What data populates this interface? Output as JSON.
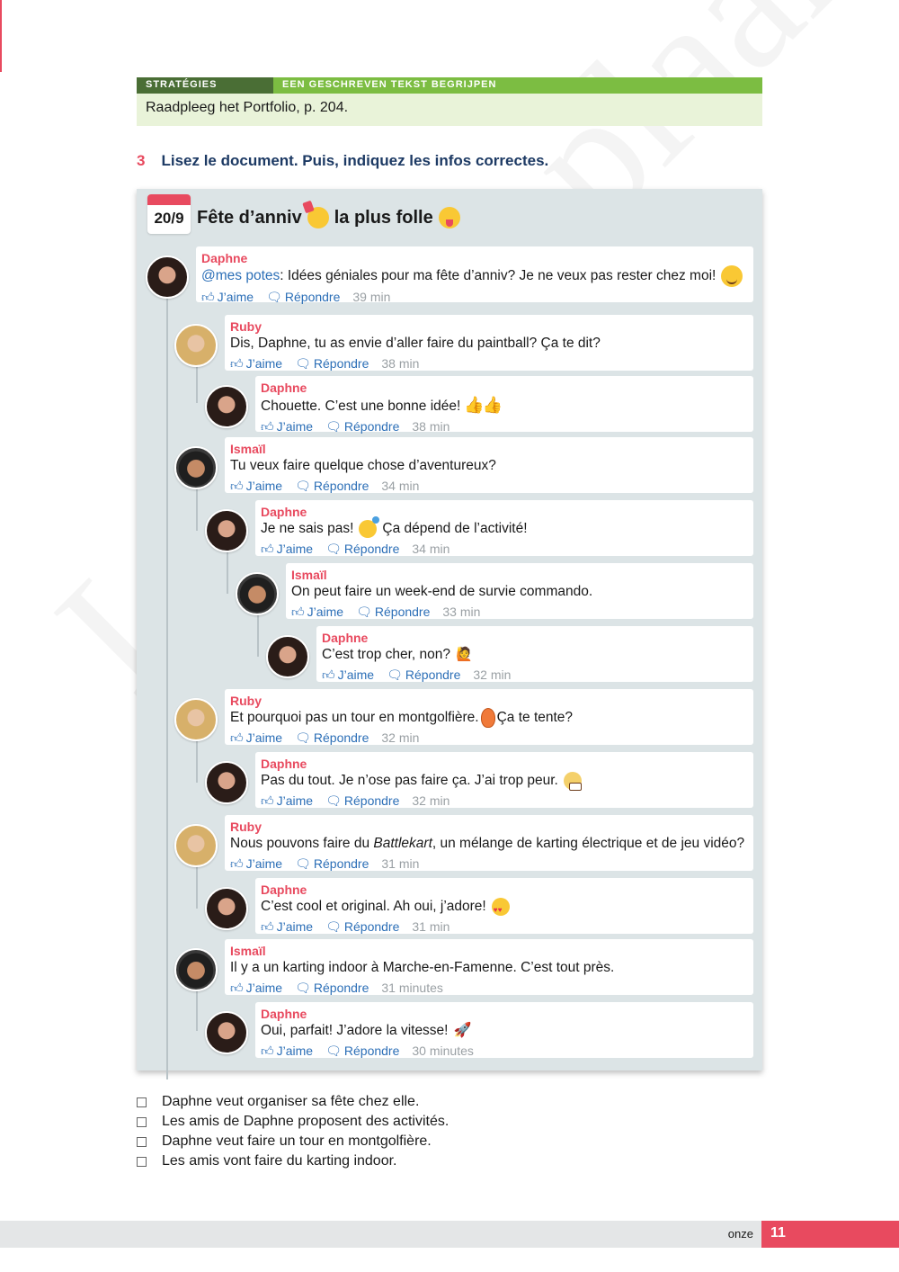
{
  "watermark": "Leeexemplaar",
  "strategies": {
    "label": "STRATÉGIES",
    "topic": "EEN GESCHREVEN TEKST BEGRIJPEN",
    "body": "Raadpleeg het Portfolio, p. 204."
  },
  "exercise": {
    "number": "3",
    "instruction": "Lisez le document. Puis, indiquez les infos correctes."
  },
  "event": {
    "date": "20/9",
    "title_part1": "Fête d’anniv",
    "title_part2": "la plus folle"
  },
  "action_labels": {
    "like": "J’aime",
    "reply": "Répondre"
  },
  "comments": [
    {
      "author": "Daphne",
      "mention": "@mes potes",
      "text": ": Idées géniales pour ma fête d’anniv? Je ne veux pas rester chez moi!",
      "time": "39 min",
      "emoji": "wink"
    },
    {
      "author": "Ruby",
      "text": "Dis, Daphne, tu as envie d’aller faire du paintball? Ça te dit?",
      "time": "38 min"
    },
    {
      "author": "Daphne",
      "text": "Chouette. C’est une bonne idée!",
      "time": "38 min",
      "emoji": "thumbs-up"
    },
    {
      "author": "Ismaïl",
      "text": "Tu veux faire quelque chose d’aventureux?",
      "time": "34 min"
    },
    {
      "author": "Daphne",
      "text": "Je ne sais pas!",
      "text2": "Ça dépend de l’activité!",
      "time": "34 min",
      "emoji": "thinking"
    },
    {
      "author": "Ismaïl",
      "text": "On peut faire un week-end de survie commando.",
      "time": "33 min"
    },
    {
      "author": "Daphne",
      "text": "C’est trop cher, non?",
      "time": "32 min",
      "emoji": "waving"
    },
    {
      "author": "Ruby",
      "text": "Et pourquoi pas un tour en montgolfière.",
      "text2": "Ça te tente?",
      "time": "32 min",
      "emoji": "hot-air-balloon"
    },
    {
      "author": "Daphne",
      "text": "Pas du tout. Je n’ose pas faire ça. J’ai trop peur.",
      "time": "32 min",
      "emoji": "grimacing"
    },
    {
      "author": "Ruby",
      "text": "Nous pouvons faire du ",
      "italic": "Battlekart",
      "text2": ", un mélange de karting électrique et de jeu vidéo?",
      "time": "31 min"
    },
    {
      "author": "Daphne",
      "text": "C’est cool et original. Ah oui, j’adore!",
      "time": "31 min",
      "emoji": "heart-eyes"
    },
    {
      "author": "Ismaïl",
      "text": "Il y a un karting indoor à Marche-en-Famenne. C’est tout près.",
      "time": "31 minutes"
    },
    {
      "author": "Daphne",
      "text": "Oui, parfait! J’adore la vitesse!",
      "time": "30 minutes",
      "emoji": "rocket"
    }
  ],
  "checklist": [
    "Daphne veut organiser sa fête chez elle.",
    "Les amis de Daphne proposent des activités.",
    "Daphne veut faire un tour en montgolfière.",
    "Les amis vont faire du karting indoor."
  ],
  "footer": {
    "word": "onze",
    "page": "11"
  },
  "colors": {
    "accent": "#e84a5f",
    "link": "#2c6fb7",
    "strategy_dark": "#4a6e35",
    "strategy_light": "#7cbd42",
    "panel": "#dce4e6"
  }
}
